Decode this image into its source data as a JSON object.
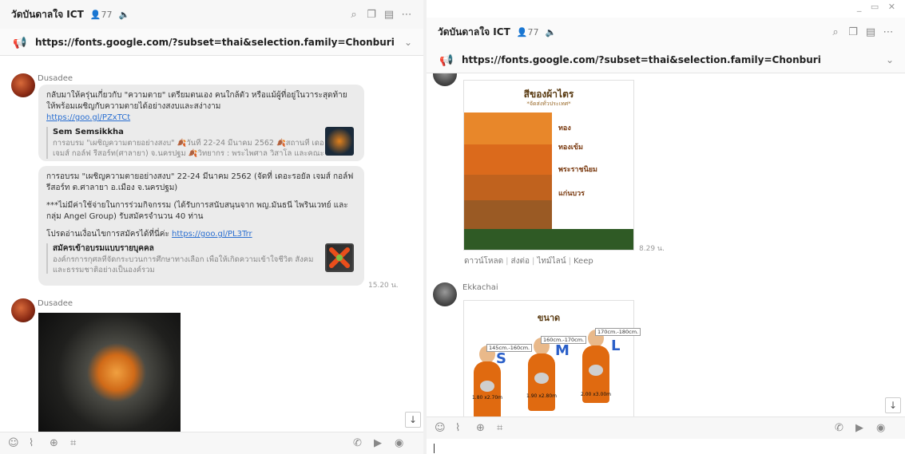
{
  "common": {
    "chat_title": "วัดบันดาลใจ ICT",
    "member_count": "77",
    "announcement_url": "https://fonts.google.com/?subset=thai&selection.family=Chonburi"
  },
  "left": {
    "messages": [
      {
        "sender": "Dusadee",
        "text": "กลับมาให้ครุ่นเกี่ยวกับ \"ความตาย\" เตรียมตนเอง คนใกล้ตัว หรือแม้ผู้ที่อยู่ในวาระสุดท้าย ให้พร้อมเผชิญกับความตายได้อย่างสงบและสง่างาม",
        "link": "https://goo.gl/PZxTCt",
        "preview_title": "Sem Semsikkha",
        "preview_desc_1": "การอบรม \"เผชิญความตายอย่างสงบ\" 🍂วันที่ 22-24 มีนาคม 2562 🍂สถานที่ เดอะรอยัล",
        "preview_desc_2": "เจมส์ กอล์ฟ รีสอร์ท(ศาลายา) จ.นครปฐม 🍂วิทยากร : พระไพศาล วิสาโล และคณะ . การอ..."
      },
      {
        "text_1": "การอบรม \"เผชิญความตายอย่างสงบ\" 22-24 มีนาคม 2562 (จัดที่ เดอะรอยัล เจมส์ กอล์ฟ รีสอร์ท ต.ศาลายา อ.เมือง จ.นครปฐม)",
        "text_2": "***ไม่มีค่าใช้จ่ายในการร่วมกิจกรรม (ได้รับการสนับสนุนจาก พญ.มันธนี ไพรินเวทย์ และ กลุ่ม Angel Group) รับสมัครจำนวน 40 ท่าน",
        "text_3": "โปรดอ่านเงื่อนไขการสมัครได้ที่นี่ค่ะ",
        "link": "https://goo.gl/PL3Trr",
        "preview_title": "สมัครเข้าอบรมแบบรายบุคคล",
        "preview_desc_1": "องค์กรการกุศลที่จัดกระบวนการศึกษาทางเลือก เพื่อให้เกิดความเข้าใจชีวิต สังคม",
        "preview_desc_2": "และธรรมชาติอย่างเป็นองค์รวม",
        "time": "15.20 น."
      },
      {
        "sender": "Dusadee"
      }
    ]
  },
  "right": {
    "poster": {
      "title": "สีของผ้าไตร",
      "subtitle": "*จัดส่งทั่วประเทศ*",
      "robes": [
        {
          "label": "ทอง",
          "color": "#e8872a"
        },
        {
          "label": "ทองเข้ม",
          "color": "#db6a1c"
        },
        {
          "label": "พระราชนิยม",
          "color": "#c0621e"
        },
        {
          "label": "แก่นบวร",
          "color": "#9a5a24"
        }
      ],
      "time": "8.29 น."
    },
    "actions": [
      "ดาวน์โหลด",
      "ส่งต่อ",
      "ไทม์ไลน์",
      "Keep"
    ],
    "second_sender": "Ekkachai",
    "size_card": {
      "title": "ขนาด",
      "sizes": [
        {
          "letter": "S",
          "range": "145cm.-160cm.",
          "dim": "1.80 x2.70m"
        },
        {
          "letter": "M",
          "range": "160cm.-170cm.",
          "dim": "1.90 x2.80m"
        },
        {
          "letter": "L",
          "range": "170cm.-180cm.",
          "dim": "2.00 x3.00m"
        }
      ]
    }
  },
  "colors": {
    "accent": "#2a6fd1",
    "bubble": "#ebebeb",
    "robe_orange": "#e06a10"
  }
}
